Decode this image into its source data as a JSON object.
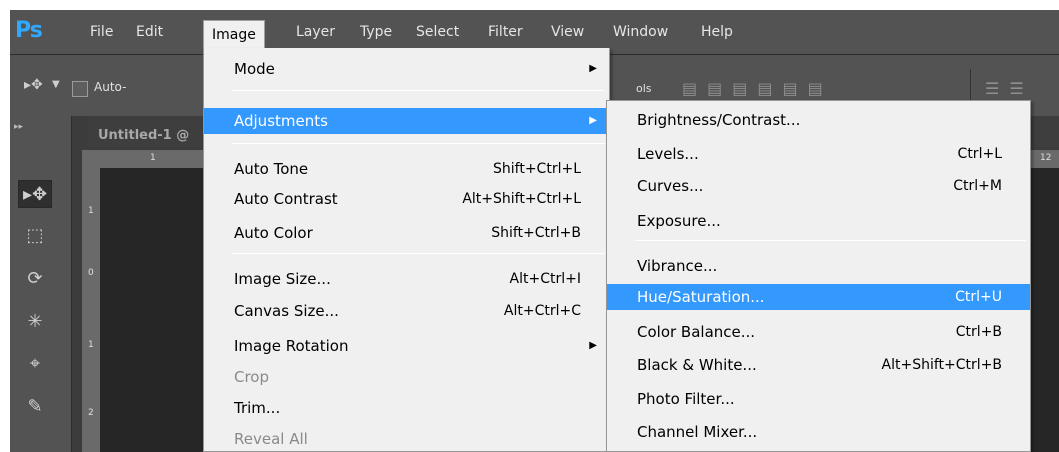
{
  "app": {
    "logo": "Ps"
  },
  "menubar": {
    "items": [
      "File",
      "Edit",
      "Image",
      "Layer",
      "Type",
      "Select",
      "Filter",
      "View",
      "Window",
      "Help"
    ]
  },
  "optionsbar": {
    "auto_label": "Auto-",
    "controls_label": "ols"
  },
  "document": {
    "tab_label": "Untitled-1 @"
  },
  "rulers": {
    "top": [
      "1",
      "12"
    ],
    "left": [
      "1",
      "0",
      "1",
      "2"
    ]
  },
  "image_menu": {
    "mode": {
      "label": "Mode"
    },
    "adjustments": {
      "label": "Adjustments"
    },
    "auto_tone": {
      "label": "Auto Tone",
      "shortcut": "Shift+Ctrl+L"
    },
    "auto_contrast": {
      "label": "Auto Contrast",
      "shortcut": "Alt+Shift+Ctrl+L"
    },
    "auto_color": {
      "label": "Auto Color",
      "shortcut": "Shift+Ctrl+B"
    },
    "image_size": {
      "label": "Image Size...",
      "shortcut": "Alt+Ctrl+I"
    },
    "canvas_size": {
      "label": "Canvas Size...",
      "shortcut": "Alt+Ctrl+C"
    },
    "image_rotation": {
      "label": "Image Rotation"
    },
    "crop": {
      "label": "Crop"
    },
    "trim": {
      "label": "Trim..."
    },
    "reveal_all": {
      "label": "Reveal All"
    }
  },
  "adjustments_menu": {
    "brightness_contrast": {
      "label": "Brightness/Contrast..."
    },
    "levels": {
      "label": "Levels...",
      "shortcut": "Ctrl+L"
    },
    "curves": {
      "label": "Curves...",
      "shortcut": "Ctrl+M"
    },
    "exposure": {
      "label": "Exposure..."
    },
    "vibrance": {
      "label": "Vibrance..."
    },
    "hue_saturation": {
      "label": "Hue/Saturation...",
      "shortcut": "Ctrl+U"
    },
    "color_balance": {
      "label": "Color Balance...",
      "shortcut": "Ctrl+B"
    },
    "black_white": {
      "label": "Black & White...",
      "shortcut": "Alt+Shift+Ctrl+B"
    },
    "photo_filter": {
      "label": "Photo Filter..."
    },
    "channel_mixer": {
      "label": "Channel Mixer..."
    }
  },
  "colors": {
    "highlight": "#3399ff",
    "menu_bg": "#f0f0f0",
    "chrome": "#535353",
    "logo": "#31a8ff"
  }
}
